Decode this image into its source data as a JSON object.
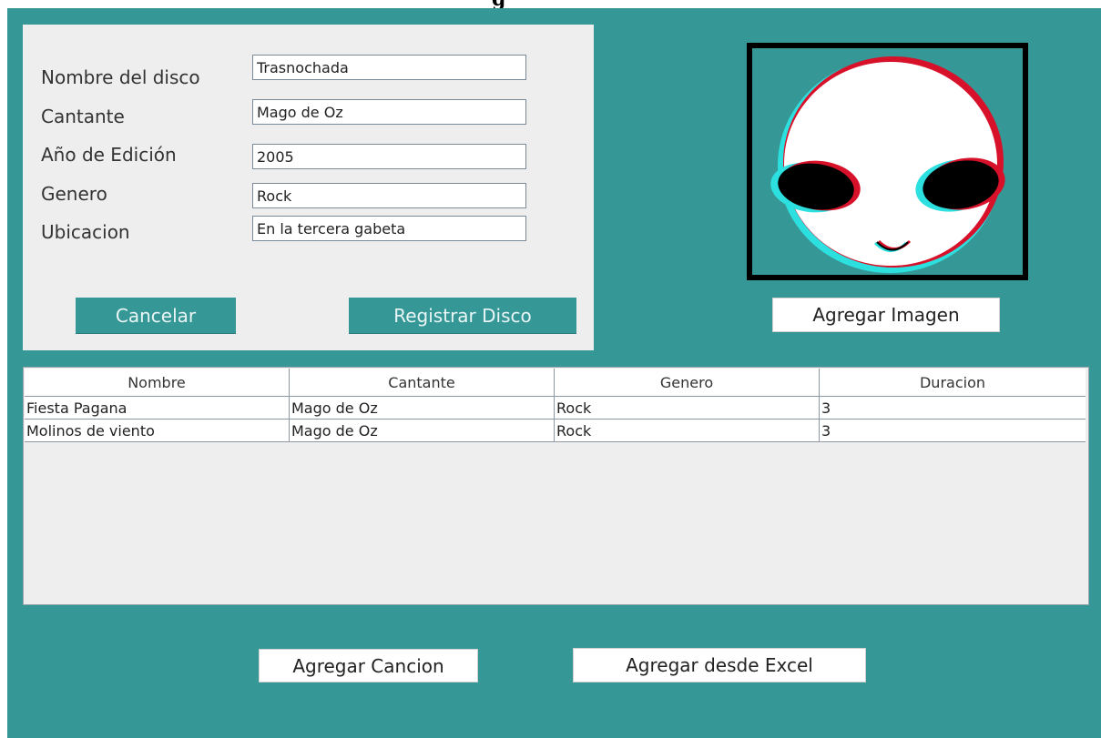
{
  "form": {
    "fields": [
      {
        "label": "Nombre del disco",
        "value": "Trasnochada"
      },
      {
        "label": "Cantante",
        "value": "Mago de Oz"
      },
      {
        "label": "Año de Edición",
        "value": "2005"
      },
      {
        "label": "Genero",
        "value": "Rock"
      },
      {
        "label": "Ubicacion",
        "value": "En la tercera gabeta"
      }
    ],
    "cancel_label": "Cancelar",
    "register_label": "Registrar Disco"
  },
  "image": {
    "icon": "alien-face-icon",
    "add_label": "Agregar Imagen"
  },
  "table": {
    "columns": [
      "Nombre",
      "Cantante",
      "Genero",
      "Duracion"
    ],
    "rows": [
      [
        "Fiesta Pagana",
        "Mago de Oz",
        "Rock",
        "3"
      ],
      [
        "Molinos de viento",
        "Mago de Oz",
        "Rock",
        "3"
      ]
    ]
  },
  "actions": {
    "add_song_label": "Agregar Cancion",
    "add_excel_label": "Agregar  desde Excel"
  },
  "colors": {
    "background": "#359796",
    "panel": "#eeeeee"
  }
}
